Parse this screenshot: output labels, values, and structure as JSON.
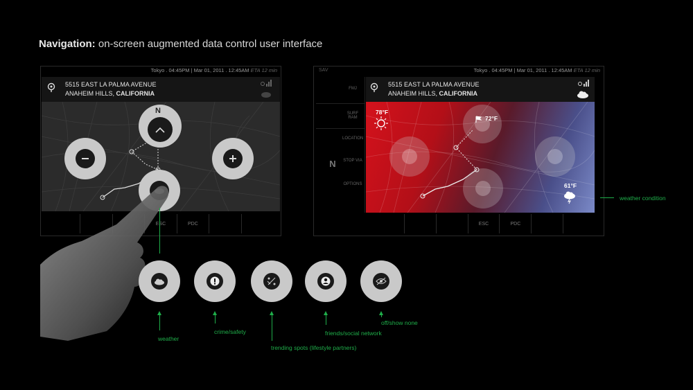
{
  "slide": {
    "title_bold": "Navigation:",
    "title_rest": " on-screen augmented data control user interface"
  },
  "screen1": {
    "status": "Tokyo . 04:45PM  |  Mar 01, 2011 . 12:45AM",
    "eta": "ETA 12 min",
    "address_line1": "5515 EAST LA PALMA AVENUE",
    "address_city": "ANAHEIM HILLS, ",
    "address_state": "CALIFORNIA",
    "compass_label": "N",
    "bottom_items": [
      "",
      "",
      "",
      "ESC",
      "PDC",
      "",
      ""
    ]
  },
  "screen2": {
    "left_status": "SAV",
    "status": "Tokyo . 04:45PM  |  Mar 01, 2011 . 12:45AM",
    "eta": "ETA 12 min",
    "address_line1": "5515 EAST LA PALMA AVENUE",
    "address_city": "ANAHEIM HILLS, ",
    "address_state": "CALIFORNIA",
    "side_items": [
      "FMJ",
      "SURF RAM",
      "LOCATION",
      "STOP VIA",
      "OPTIONS"
    ],
    "side_compass": "N",
    "temp_left": "78°F",
    "temp_top": "72°F",
    "temp_right": "61°F",
    "bottom_items": [
      "",
      "",
      "",
      "ESC",
      "PDC",
      "",
      ""
    ]
  },
  "layers": [
    {
      "icon": "cloud-icon",
      "label": "weather"
    },
    {
      "icon": "exclamation-icon",
      "label": "crime/safety"
    },
    {
      "icon": "trending-icon",
      "label": "trending spots (lifestyle partners)"
    },
    {
      "icon": "person-icon",
      "label": "friends/social network"
    },
    {
      "icon": "eye-off-icon",
      "label": "off/show none"
    }
  ],
  "annotation": "weather condition",
  "colors": {
    "accent_green": "#1fae4a",
    "heat_red": "#c8101a",
    "cool_blue": "#6f7fc0"
  }
}
